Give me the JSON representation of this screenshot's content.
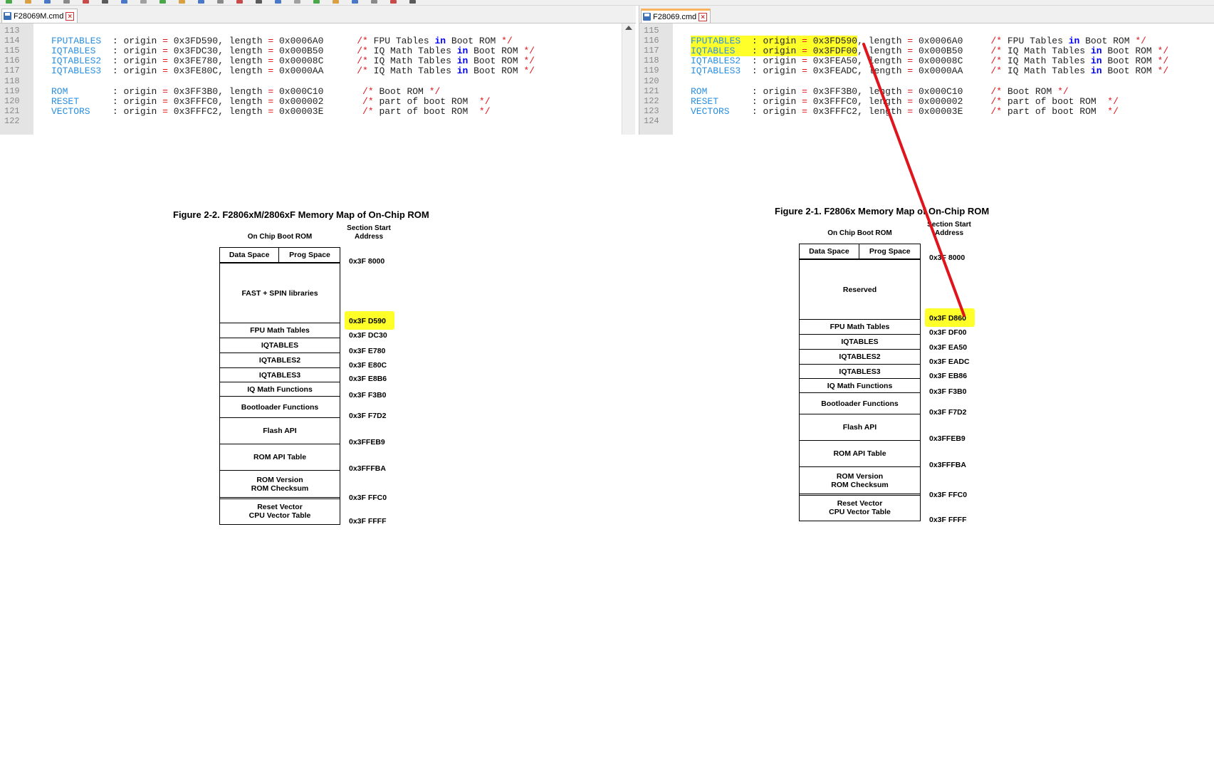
{
  "colors": {
    "highlight": "#ffff2a",
    "symbol": "#2a8fe0",
    "operator": "#e0141c",
    "keyword": "#0000ff",
    "arrow": "#e0141c",
    "tab_accent": "#fab35f"
  },
  "toolbar": {
    "icons": [
      "new-file-icon",
      "open-icon",
      "save-icon",
      "save-all-icon",
      "close-icon",
      "print-icon",
      "cut-icon",
      "copy-icon",
      "paste-icon",
      "undo-icon",
      "redo-icon",
      "find-icon",
      "replace-icon",
      "zoom-in-icon",
      "zoom-out-icon",
      "sync-icon",
      "wrap-icon",
      "indent-icon",
      "bookmark-icon",
      "macro-record-icon",
      "macro-play-icon",
      "run-icon"
    ]
  },
  "left_editor": {
    "tab_label": "F28069M.cmd",
    "lines": [
      {
        "no": "113",
        "sym": "",
        "origin": "",
        "length": "",
        "comment": ""
      },
      {
        "no": "114",
        "sym": "FPUTABLES",
        "origin": "0x3FD590",
        "length": "0x0006A0",
        "comment": "FPU Tables",
        "kw": "in",
        "tail": "Boot ROM",
        "pad": "      "
      },
      {
        "no": "115",
        "sym": "IQTABLES",
        "origin": "0x3FDC30",
        "length": "0x000B50",
        "comment": "IQ Math Tables",
        "kw": "in",
        "tail": "Boot ROM",
        "pad": "      "
      },
      {
        "no": "116",
        "sym": "IQTABLES2",
        "origin": "0x3FE780",
        "length": "0x00008C",
        "comment": "IQ Math Tables",
        "kw": "in",
        "tail": "Boot ROM",
        "pad": "      "
      },
      {
        "no": "117",
        "sym": "IQTABLES3",
        "origin": "0x3FE80C",
        "length": "0x0000AA",
        "comment": "IQ Math Tables",
        "kw": "in",
        "tail": "Boot ROM",
        "pad": "      "
      },
      {
        "no": "118",
        "sym": "",
        "origin": "",
        "length": "",
        "comment": ""
      },
      {
        "no": "119",
        "sym": "ROM",
        "origin": "0x3FF3B0",
        "length": "0x000C10",
        "comment": "Boot ROM",
        "kw": "",
        "tail": "",
        "pad": "       "
      },
      {
        "no": "120",
        "sym": "RESET",
        "origin": "0x3FFFC0",
        "length": "0x000002",
        "comment": "part of boot ROM ",
        "kw": "",
        "tail": "",
        "pad": "       "
      },
      {
        "no": "121",
        "sym": "VECTORS",
        "origin": "0x3FFFC2",
        "length": "0x00003E",
        "comment": "part of boot ROM ",
        "kw": "",
        "tail": "",
        "pad": "       "
      },
      {
        "no": "122",
        "sym": "",
        "origin": "",
        "length": "",
        "comment": ""
      }
    ]
  },
  "right_editor": {
    "tab_label": "F28069.cmd",
    "lines": [
      {
        "no": "115",
        "sym": "",
        "origin": "",
        "length": "",
        "comment": ""
      },
      {
        "no": "116",
        "sym": "FPUTABLES",
        "origin": "0x3FD590",
        "length": "0x0006A0",
        "comment": "FPU Tables",
        "kw": "in",
        "tail": "Boot ROM",
        "pad": "     ",
        "hl": true
      },
      {
        "no": "117",
        "sym": "IQTABLES",
        "origin": "0x3FDF00",
        "length": "0x000B50",
        "comment": "IQ Math Tables",
        "kw": "in",
        "tail": "Boot ROM",
        "pad": "     ",
        "hl": true
      },
      {
        "no": "118",
        "sym": "IQTABLES2",
        "origin": "0x3FEA50",
        "length": "0x00008C",
        "comment": "IQ Math Tables",
        "kw": "in",
        "tail": "Boot ROM",
        "pad": "     "
      },
      {
        "no": "119",
        "sym": "IQTABLES3",
        "origin": "0x3FEADC",
        "length": "0x0000AA",
        "comment": "IQ Math Tables",
        "kw": "in",
        "tail": "Boot ROM",
        "pad": "     "
      },
      {
        "no": "120",
        "sym": "",
        "origin": "",
        "length": "",
        "comment": ""
      },
      {
        "no": "121",
        "sym": "ROM",
        "origin": "0x3FF3B0",
        "length": "0x000C10",
        "comment": "Boot ROM",
        "kw": "",
        "tail": "",
        "pad": "     "
      },
      {
        "no": "122",
        "sym": "RESET",
        "origin": "0x3FFFC0",
        "length": "0x000002",
        "comment": "part of boot ROM ",
        "kw": "",
        "tail": "",
        "pad": "     "
      },
      {
        "no": "123",
        "sym": "VECTORS",
        "origin": "0x3FFFC2",
        "length": "0x00003E",
        "comment": "part of boot ROM ",
        "kw": "",
        "tail": "",
        "pad": "     "
      },
      {
        "no": "124",
        "sym": "",
        "origin": "",
        "length": "",
        "comment": ""
      }
    ]
  },
  "code_tokens": {
    "colon": ":",
    "origin_kw": "origin",
    "eq": "=",
    "comma": ",",
    "length_kw": "length",
    "cm_open": "/*",
    "cm_close": "*/"
  },
  "fig_left": {
    "title": "Figure 2-2. F2806xM/2806xF Memory Map of On-Chip ROM",
    "col_boot": "On Chip Boot ROM",
    "col_addr": "Section Start\nAddress",
    "data_space": "Data Space",
    "prog_space": "Prog Space",
    "blocks": [
      {
        "label": "FAST + SPIN libraries"
      },
      {
        "label": "FPU Math Tables"
      },
      {
        "label": "IQTABLES"
      },
      {
        "label": "IQTABLES2"
      },
      {
        "label": "IQTABLES3"
      },
      {
        "label": "IQ Math Functions"
      },
      {
        "label": "Bootloader Functions"
      },
      {
        "label": "Flash API"
      },
      {
        "label": "ROM API Table"
      },
      {
        "label": "ROM Version\nROM Checksum"
      },
      {
        "label": "Reset Vector\nCPU Vector Table"
      }
    ],
    "addresses": [
      {
        "text": "0x3F 8000"
      },
      {
        "text": "0x3F D590",
        "hl": true
      },
      {
        "text": "0x3F DC30"
      },
      {
        "text": "0x3F E780"
      },
      {
        "text": "0x3F E80C"
      },
      {
        "text": "0x3F E8B6"
      },
      {
        "text": "0x3F F3B0"
      },
      {
        "text": "0x3F F7D2"
      },
      {
        "text": "0x3FFEB9"
      },
      {
        "text": "0x3FFFBA"
      },
      {
        "text": "0x3F FFC0"
      },
      {
        "text": "0x3F FFFF"
      }
    ]
  },
  "fig_right": {
    "title": "Figure 2-1. F2806x Memory Map of On-Chip ROM",
    "col_boot": "On Chip Boot ROM",
    "col_addr": "Section Start\nAddress",
    "data_space": "Data Space",
    "prog_space": "Prog Space",
    "blocks": [
      {
        "label": "Reserved"
      },
      {
        "label": "FPU Math Tables"
      },
      {
        "label": "IQTABLES"
      },
      {
        "label": "IQTABLES2"
      },
      {
        "label": "IQTABLES3"
      },
      {
        "label": "IQ Math Functions"
      },
      {
        "label": "Bootloader Functions"
      },
      {
        "label": "Flash API"
      },
      {
        "label": "ROM API Table"
      },
      {
        "label": "ROM Version\nROM Checksum"
      },
      {
        "label": "Reset Vector\nCPU Vector Table"
      }
    ],
    "addresses": [
      {
        "text": "0x3F 8000"
      },
      {
        "text": "0x3F D860",
        "hl": true
      },
      {
        "text": "0x3F DF00"
      },
      {
        "text": "0x3F EA50"
      },
      {
        "text": "0x3F EADC"
      },
      {
        "text": "0x3F EB86"
      },
      {
        "text": "0x3F F3B0"
      },
      {
        "text": "0x3F F7D2"
      },
      {
        "text": "0x3FFEB9"
      },
      {
        "text": "0x3FFFBA"
      },
      {
        "text": "0x3F FFC0"
      },
      {
        "text": "0x3F FFFF"
      }
    ]
  }
}
